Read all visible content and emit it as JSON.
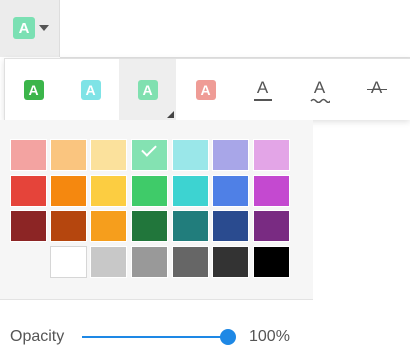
{
  "toolbar": {
    "trigger_letter": "A",
    "trigger_color": "#7be0b3"
  },
  "style_options": [
    {
      "name": "style-green-solid",
      "letter": "A",
      "bg": "#3bb54a",
      "fg": "#ffffff",
      "kind": "chip",
      "active": false
    },
    {
      "name": "style-cyan-light",
      "letter": "A",
      "bg": "#7fe3e6",
      "fg": "#ffffff",
      "kind": "chip",
      "active": false
    },
    {
      "name": "style-mint-light",
      "letter": "A",
      "bg": "#80e0b0",
      "fg": "#ffffff",
      "kind": "chip",
      "active": true
    },
    {
      "name": "style-salmon",
      "letter": "A",
      "bg": "#ef9c96",
      "fg": "#ffffff",
      "kind": "chip",
      "active": false
    },
    {
      "name": "style-underline",
      "letter": "A",
      "kind": "underline",
      "active": false
    },
    {
      "name": "style-wavy-underline",
      "letter": "A",
      "kind": "wavy",
      "active": false
    },
    {
      "name": "style-strikethrough",
      "letter": "A",
      "kind": "strike",
      "active": false
    }
  ],
  "palette": [
    [
      "#f3a3a1",
      "#fac57f",
      "#fbe19c",
      "#84e2b2",
      "#9ae7e9",
      "#a8a6e8",
      "#e3a5e7"
    ],
    [
      "#e5443a",
      "#f5880f",
      "#fccd41",
      "#3fcb69",
      "#3dd3d1",
      "#4f80e6",
      "#c449d0"
    ],
    [
      "#8c2525",
      "#b5460e",
      "#f69e1c",
      "#21763b",
      "#217d7c",
      "#2a4b8f",
      "#792b82"
    ],
    [
      "none",
      "#ffffff",
      "#c8c8c8",
      "#999999",
      "#666666",
      "#333333",
      "#000000"
    ]
  ],
  "selected_swatch": {
    "row": 0,
    "col": 3
  },
  "opacity": {
    "label": "Opacity",
    "value": 1.0,
    "value_text": "100%",
    "accent": "#1e88e5"
  }
}
